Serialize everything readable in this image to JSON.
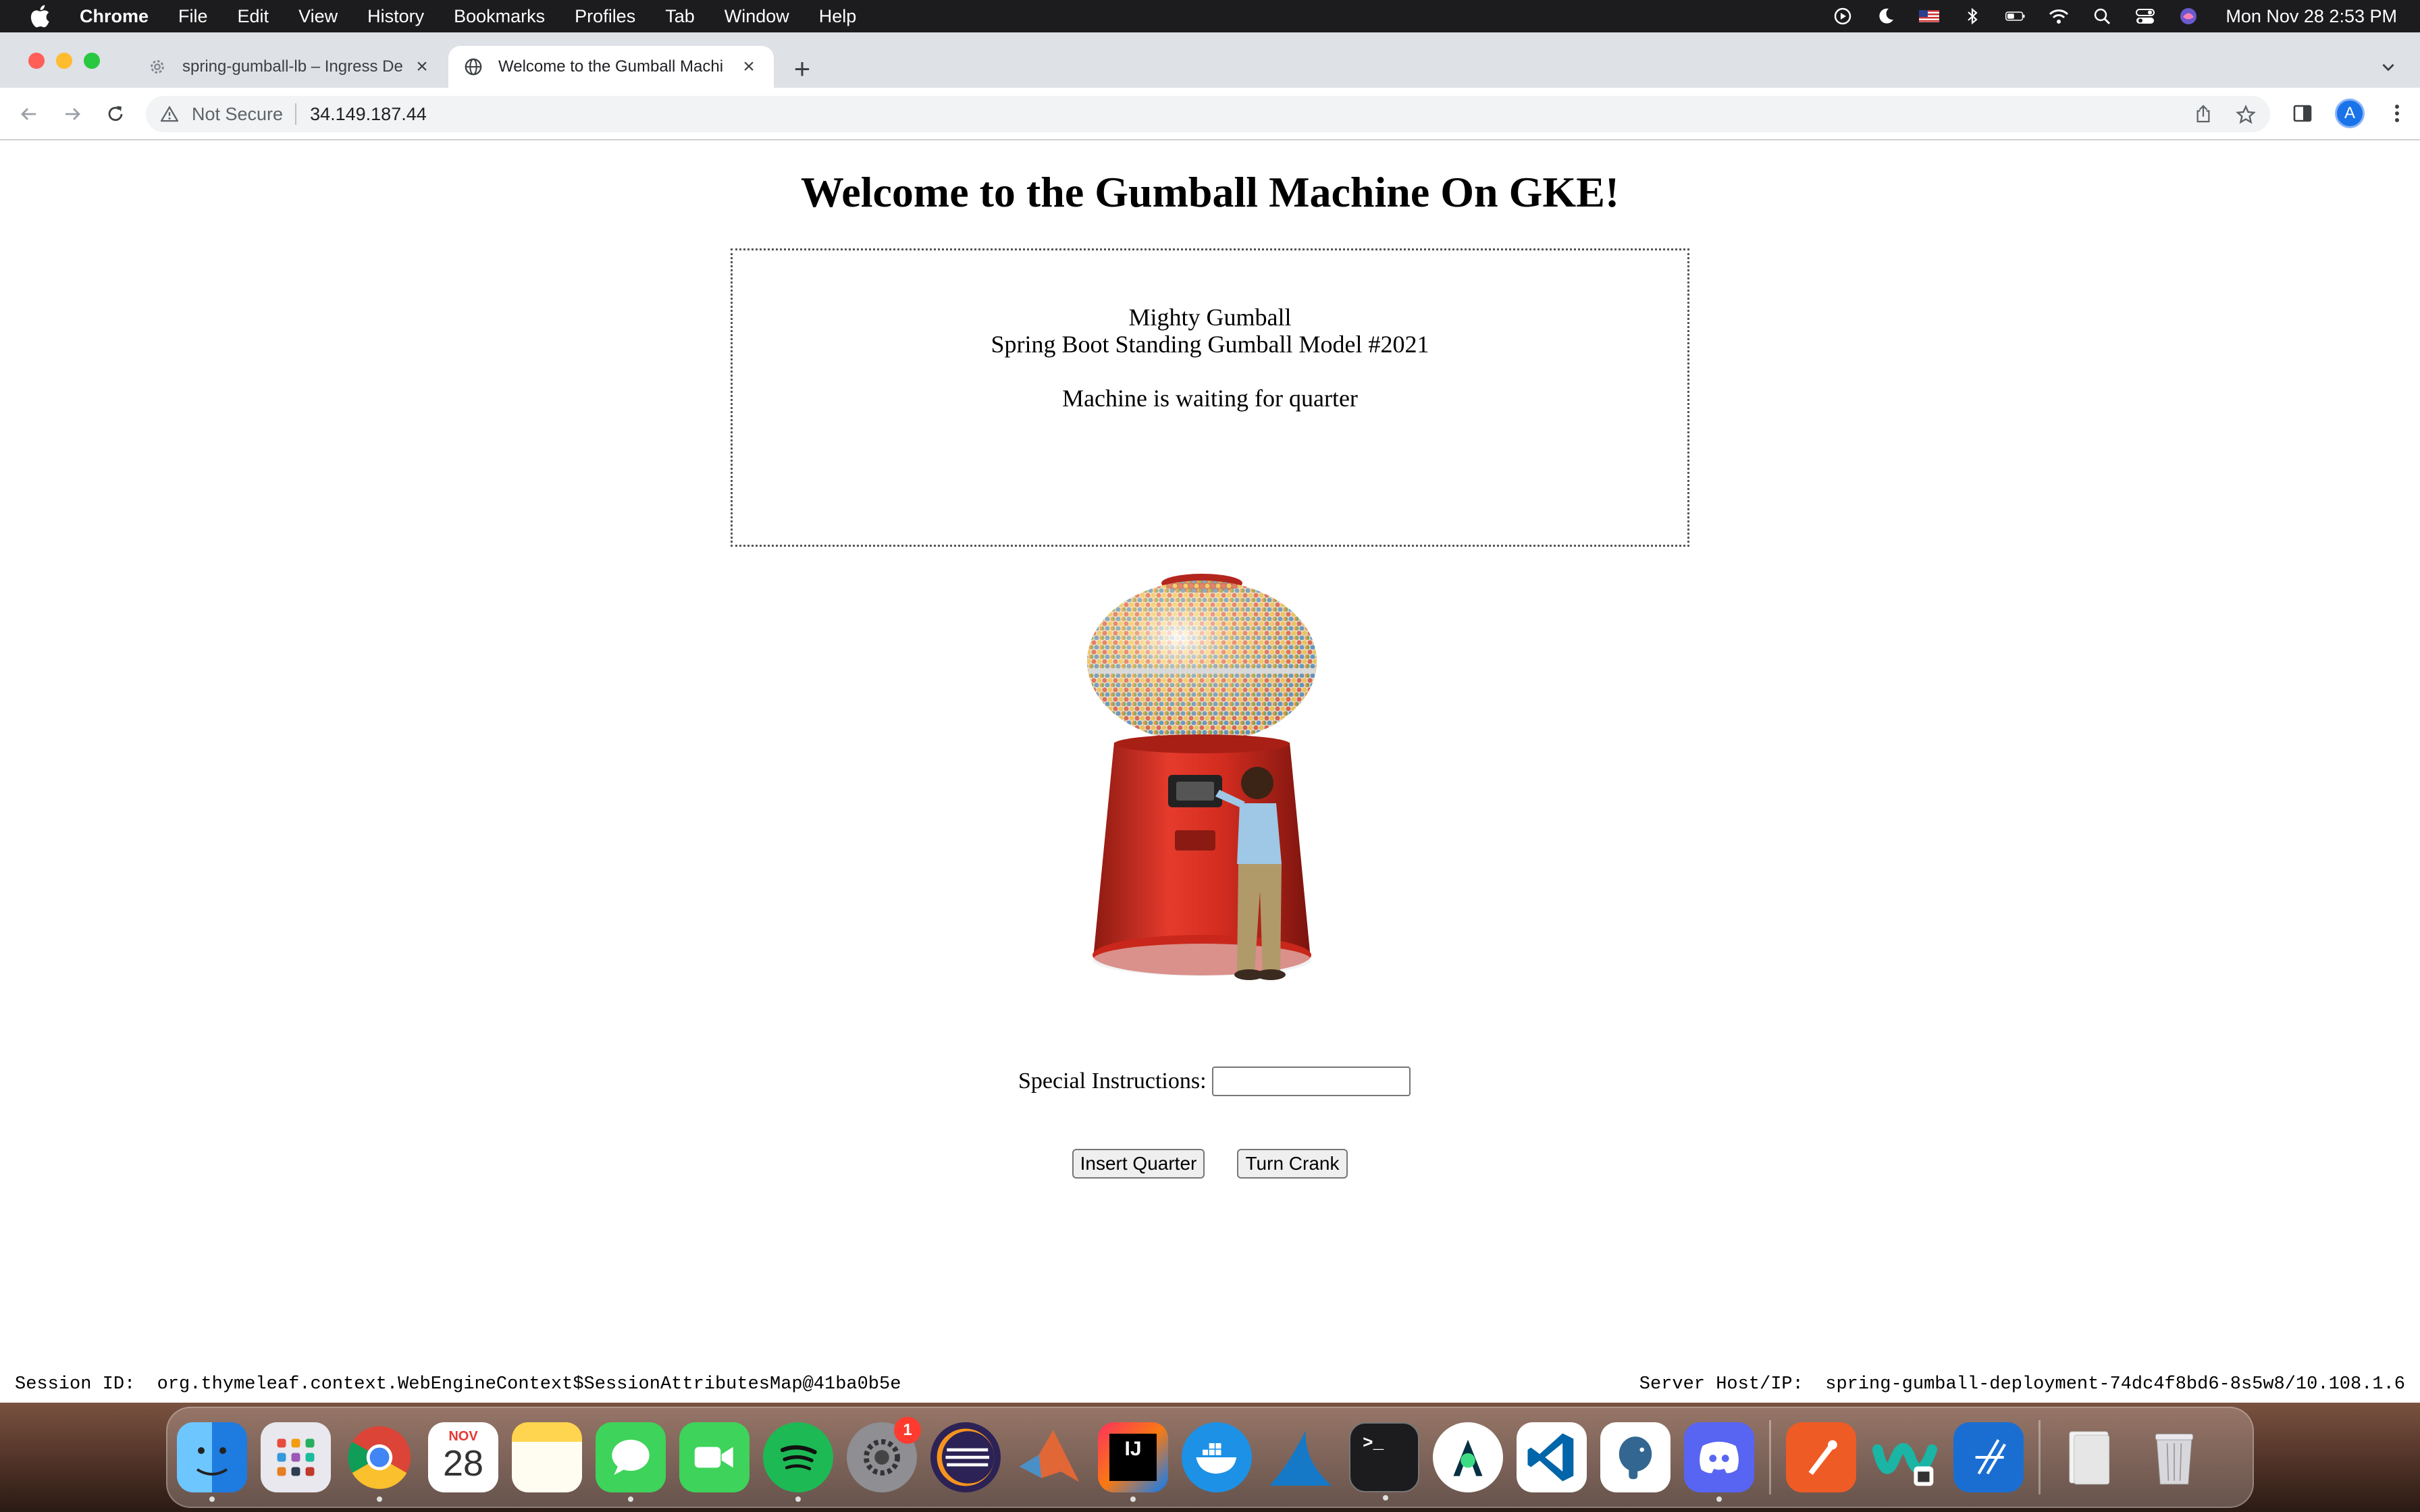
{
  "menubar": {
    "app_name": "Chrome",
    "items": [
      "File",
      "Edit",
      "View",
      "History",
      "Bookmarks",
      "Profiles",
      "Tab",
      "Window",
      "Help"
    ],
    "clock": "Mon Nov 28  2:53 PM"
  },
  "browser": {
    "tabs": [
      {
        "title": "spring-gumball-lb – Ingress De",
        "active": false
      },
      {
        "title": "Welcome to the Gumball Machi",
        "active": true
      }
    ],
    "not_secure_label": "Not Secure",
    "url": "34.149.187.44",
    "profile_initial": "A"
  },
  "page": {
    "heading": "Welcome to the Gumball Machine On GKE!",
    "machine_name": "Mighty Gumball",
    "model": "Spring Boot Standing Gumball Model #2021",
    "status": "Machine is waiting for quarter",
    "instructions_label": "Special Instructions:",
    "instructions_value": "",
    "insert_button": "Insert Quarter",
    "crank_button": "Turn Crank",
    "session_label": "Session ID:",
    "session_value": "org.thymeleaf.context.WebEngineContext$SessionAttributesMap@41ba0b5e",
    "server_label": "Server Host/IP:",
    "server_value": "spring-gumball-deployment-74dc4f8bd6-8s5w8/10.108.1.6"
  },
  "dock": {
    "calendar_month": "NOV",
    "calendar_day": "28",
    "settings_badge": "1",
    "apps": [
      "finder",
      "launchpad",
      "chrome",
      "calendar",
      "notes",
      "messages",
      "facetime",
      "spotify",
      "system-settings",
      "eclipse",
      "matlab",
      "intellij",
      "docker",
      "wireshark",
      "terminal",
      "android-studio",
      "vscode",
      "postgres",
      "discord",
      "postman",
      "webex",
      "xcode",
      "files",
      "trash"
    ]
  }
}
